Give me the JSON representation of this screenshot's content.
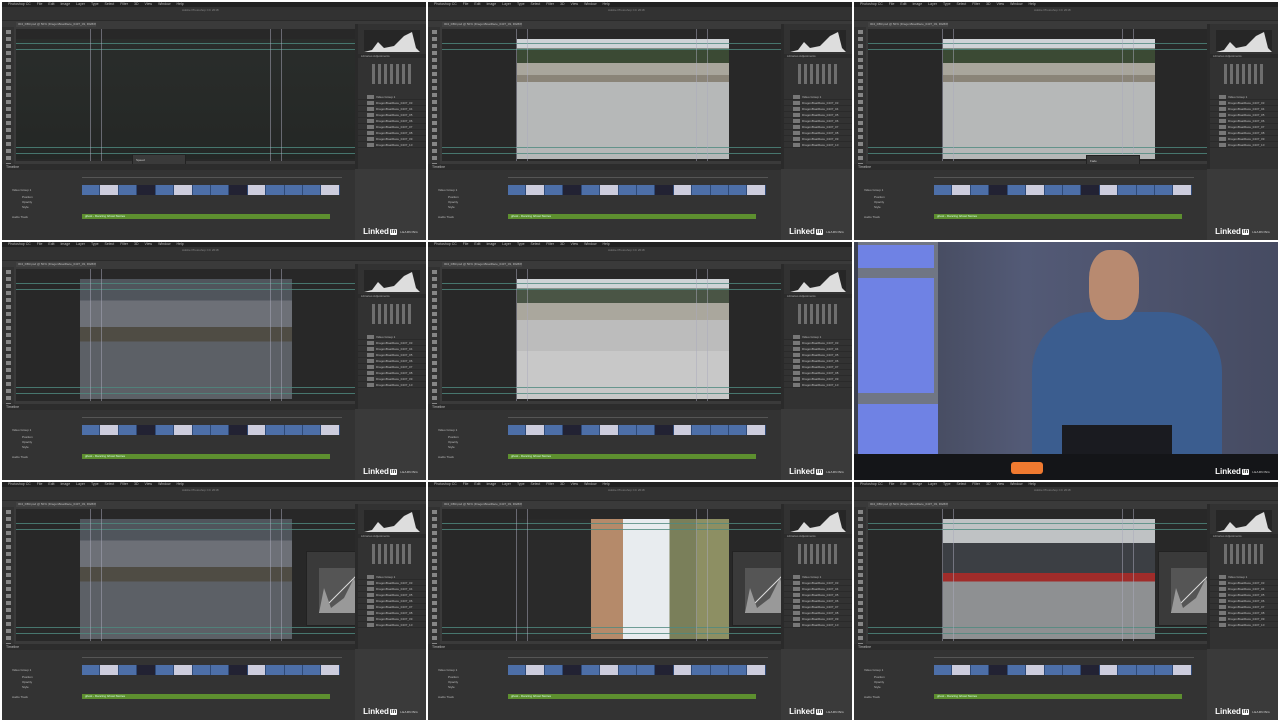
{
  "app": {
    "menu": [
      "Photoshop CC",
      "File",
      "Edit",
      "Image",
      "Layer",
      "Type",
      "Select",
      "Filter",
      "3D",
      "View",
      "Window",
      "Help"
    ],
    "window_title": "Adobe Photoshop CC 2018",
    "doc_tab": "004_DB3.psd @ 50% (DragonBoatRace_0437_03, RGB/8)",
    "panel_tabs": "Histogram  Navigator",
    "adjust_tabs": "Libraries  Adjustments",
    "timeline_title": "Timeline",
    "video_group": "Video Group 1",
    "track_props": [
      "Position",
      "Opacity",
      "Style"
    ],
    "audio_track": "Audio Track",
    "audio_clip": "ghost - Dancing Ghost Stories",
    "layers": [
      "Video Group 1",
      "DragonBoatRace_0437_03",
      "DragonBoatRace_0437_04",
      "DragonBoatRace_0437_05",
      "DragonBoatRace_0437_06",
      "DragonBoatRace_0437_07",
      "DragonBoatRace_0437_08",
      "DragonBoatRace_0437_09",
      "DragonBoatRace_0437_10"
    ]
  },
  "watermark": {
    "brand": "Linked",
    "in": "in",
    "learning": "LEARNING"
  },
  "tiles": [
    {
      "scene": "dark-water",
      "dialog": "Speed"
    },
    {
      "scene": "lake"
    },
    {
      "scene": "lake",
      "dialog": "Fade"
    },
    {
      "scene": "marina"
    },
    {
      "scene": "ghost-lake"
    },
    {
      "scene": "presenter"
    },
    {
      "scene": "marina",
      "curves": true
    },
    {
      "scene": "dog",
      "curves": true
    },
    {
      "scene": "rowers",
      "curves": true
    }
  ]
}
